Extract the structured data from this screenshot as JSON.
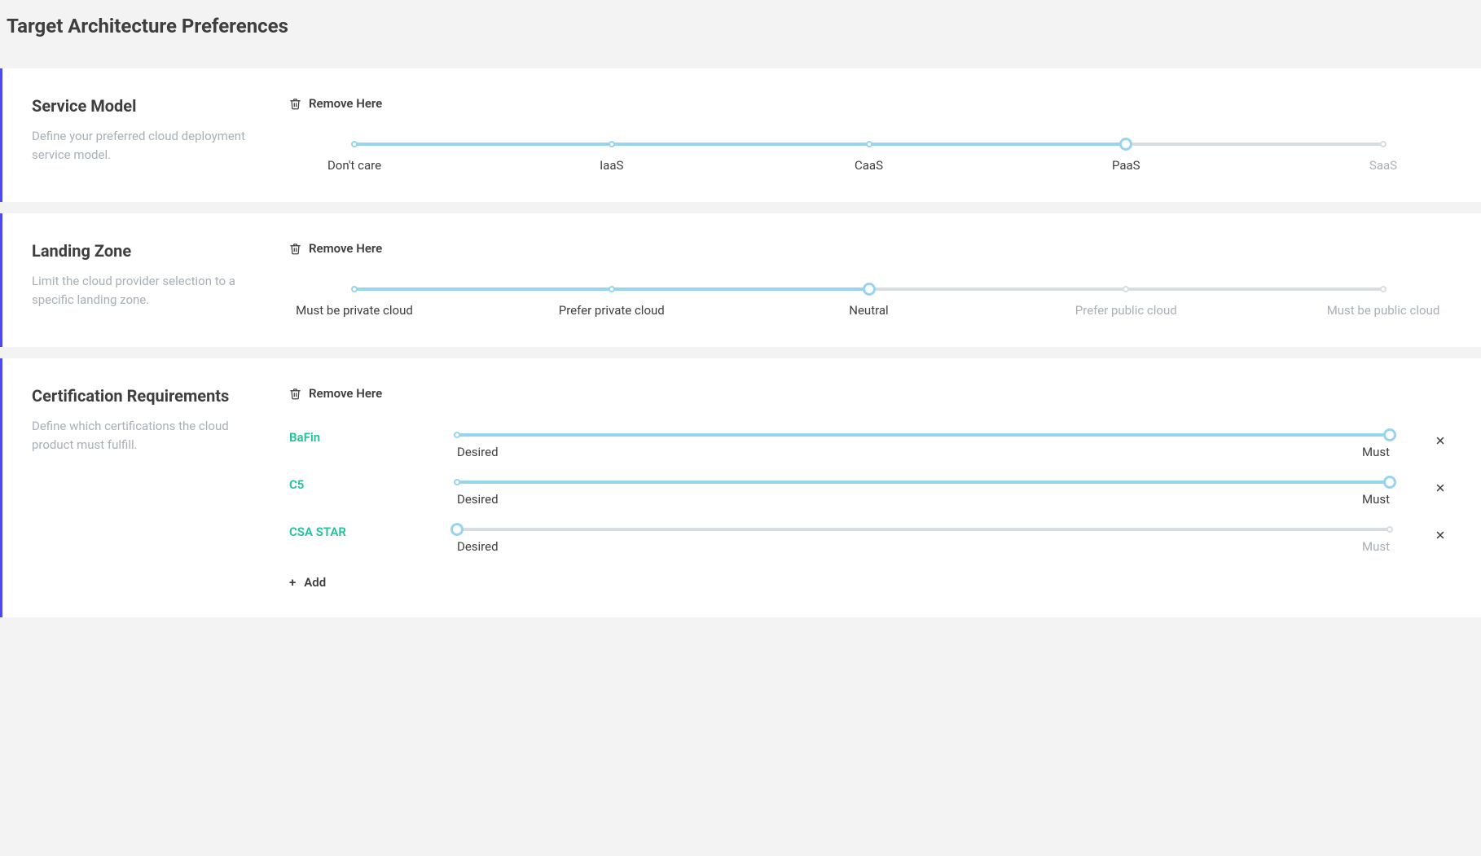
{
  "page": {
    "title": "Target Architecture Preferences"
  },
  "common": {
    "remove_label": "Remove Here",
    "add_label": "Add"
  },
  "sections": {
    "service_model": {
      "title": "Service Model",
      "description": "Define your preferred cloud deployment service model.",
      "slider": {
        "options": [
          "Don't care",
          "IaaS",
          "CaaS",
          "PaaS",
          "SaaS"
        ],
        "selected_index": 3
      }
    },
    "landing_zone": {
      "title": "Landing Zone",
      "description": "Limit the cloud provider selection to a specific landing zone.",
      "slider": {
        "options": [
          "Must be private cloud",
          "Prefer private cloud",
          "Neutral",
          "Prefer public cloud",
          "Must be public cloud"
        ],
        "selected_index": 2
      }
    },
    "certifications": {
      "title": "Certification Requirements",
      "description": "Define which certifications the cloud product must fulfill.",
      "endpoints": {
        "left": "Desired",
        "right": "Must"
      },
      "items": [
        {
          "name": "BaFin",
          "value_index": 1
        },
        {
          "name": "C5",
          "value_index": 1
        },
        {
          "name": "CSA STAR",
          "value_index": 0
        }
      ]
    }
  }
}
